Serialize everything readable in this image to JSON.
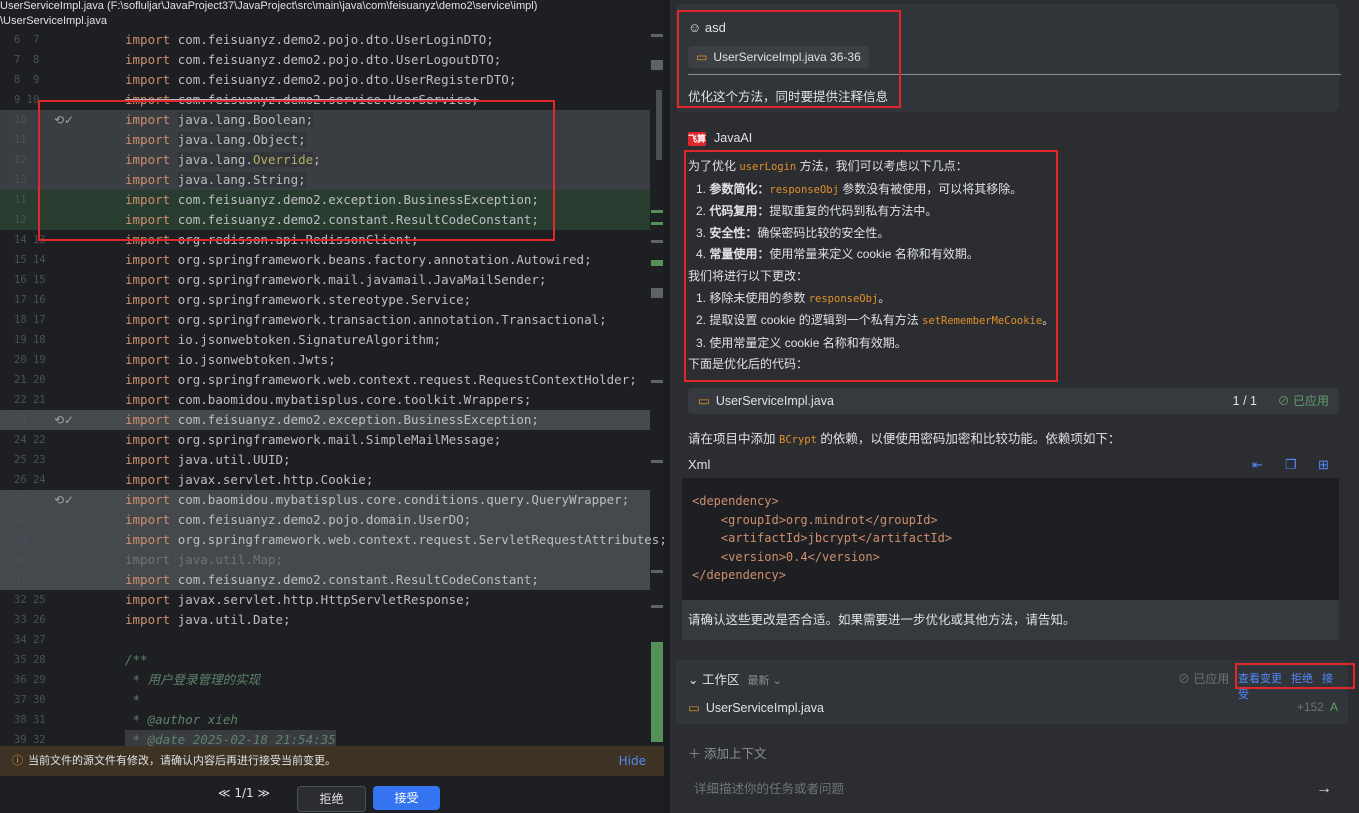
{
  "editor": {
    "path_line1": "UserServiceImpl.java (F:\\sofluljar\\JavaProject37\\JavaProject\\src\\main\\java\\com\\feisuanyz\\demo2\\service\\impl)",
    "path_line2": "\\UserServiceImpl.java",
    "lines": [
      {
        "ln": "6  7",
        "text": "com.feisuanyz.demo2.pojo.dto.UserLoginDTO;"
      },
      {
        "ln": "7  8",
        "text": "com.feisuanyz.demo2.pojo.dto.UserLogoutDTO;"
      },
      {
        "ln": "8  9",
        "text": "com.feisuanyz.demo2.pojo.dto.UserRegisterDTO;"
      },
      {
        "ln": "9 10",
        "text": "com.feisuanyz.demo2.service.UserService;"
      },
      {
        "ln": "10",
        "text": "java.lang.Boolean;"
      },
      {
        "ln": "11",
        "text": "java.lang.Object;"
      },
      {
        "ln": "12",
        "text": "java.lang."
      },
      {
        "ln": "13",
        "text": "java.lang.String;"
      },
      {
        "ln": "11",
        "text": "com.feisuanyz.demo2.exception.BusinessException;"
      },
      {
        "ln": "12",
        "text": "com.feisuanyz.demo2.constant.ResultCodeConstant;"
      },
      {
        "ln": "14 13",
        "text": "org.redisson.api.RedissonClient;"
      },
      {
        "ln": "15 14",
        "text": "org.springframework.beans.factory.annotation.Autowired;"
      },
      {
        "ln": "16 15",
        "text": "org.springframework.mail.javamail.JavaMailSender;"
      },
      {
        "ln": "17 16",
        "text": "org.springframework.stereotype.Service;"
      },
      {
        "ln": "18 17",
        "text": "org.springframework.transaction.annotation.Transactional;"
      },
      {
        "ln": "19 18",
        "text": "io.jsonwebtoken.SignatureAlgorithm;"
      },
      {
        "ln": "20 19",
        "text": "io.jsonwebtoken.Jwts;"
      },
      {
        "ln": "21 20",
        "text": "org.springframework.web.context.request.RequestContextHolder;"
      },
      {
        "ln": "22 21",
        "text": "com.baomidou.mybatisplus.core.toolkit.Wrappers;"
      },
      {
        "ln": "23",
        "text": "com.feisuanyz.demo2.exception.BusinessException;"
      },
      {
        "ln": "24 22",
        "text": "org.springframework.mail.SimpleMailMessage;"
      },
      {
        "ln": "25 23",
        "text": "java.util.UUID;"
      },
      {
        "ln": "26 24",
        "text": "javax.servlet.http.Cookie;"
      },
      {
        "ln": "27",
        "text": "com.baomidou.mybatisplus.core.conditions.query.QueryWrapper;"
      },
      {
        "ln": "28",
        "text": "com.feisuanyz.demo2.pojo.domain.UserDO;"
      },
      {
        "ln": "29",
        "text": "org.springframework.web.context.request.ServletRequestAttributes;"
      },
      {
        "ln": "30",
        "text": "java.util.Map;"
      },
      {
        "ln": "31",
        "text": "com.feisuanyz.demo2.constant.ResultCodeConstant;"
      },
      {
        "ln": "32 25",
        "text": "javax.servlet.http.HttpServletResponse;"
      },
      {
        "ln": "33 26",
        "text": "java.util.Date;"
      }
    ],
    "keyword": "import",
    "override_word": "Override",
    "revert_glyph": "⟲✓",
    "comment_open": "/**",
    "comment_line1": " * 用户登录管理的实现",
    "comment_line2": " *",
    "comment_line3": " * @author xieh",
    "comment_line4": " * @date 2025-02-18 21:54:35",
    "ln_34": "34 27",
    "ln_35": "35 28",
    "ln_36": "36 29",
    "ln_37": "37 30",
    "ln_38": "38 31",
    "ln_39": "39 32"
  },
  "notification": {
    "text": "当前文件的源文件有修改，请确认内容后再进行接受当前变更。",
    "hide": "Hide"
  },
  "diffbar": {
    "nav": "≪ 1/1 ≫",
    "reject": "拒绝",
    "accept": "接受"
  },
  "chat": {
    "user_name": "asd",
    "user_chip": "UserServiceImpl.java 36-36",
    "question": "优化这个方法，同时要提供注释信息",
    "ai_name": "JavaAI",
    "ai_logo": "飞算",
    "intro_a": "为了优化",
    "intro_code": "userLogin",
    "intro_b": "方法，我们可以考虑以下几点：",
    "points": [
      {
        "n": "1.",
        "b": "参数简化：",
        "code": "responseObj",
        "t": "参数没有被使用，可以将其移除。"
      },
      {
        "n": "2.",
        "b": "代码复用：",
        "code": "",
        "t": "提取重复的代码到私有方法中。"
      },
      {
        "n": "3.",
        "b": "安全性：",
        "code": "",
        "t": "确保密码比较的安全性。"
      },
      {
        "n": "4.",
        "b": "常量使用：",
        "code": "",
        "t": "使用常量来定义 cookie 名称和有效期。"
      }
    ],
    "changes_title": "我们将进行以下更改：",
    "changes": [
      {
        "n": "1.",
        "t": "移除未使用的参数",
        "code": "responseObj",
        "t2": "。"
      },
      {
        "n": "2.",
        "t": "提取设置 cookie 的逻辑到一个私有方法",
        "code": "setRememberMeCookie",
        "t2": "。"
      },
      {
        "n": "3.",
        "t": "使用常量定义 cookie 名称和有效期。",
        "code": "",
        "t2": ""
      }
    ],
    "after": "下面是优化后的代码：",
    "applied_file": "UserServiceImpl.java",
    "applied_count": "1 / 1",
    "applied_status": "已应用",
    "para_a": "请在项目中添加",
    "para_code": "BCrypt",
    "para_b": "的依赖，以便使用密码加密和比较功能。依赖项如下：",
    "xml_label": "Xml",
    "xml_lines": [
      "<dependency>",
      "    <groupId>org.mindrot</groupId>",
      "    <artifactId>jbcrypt</artifactId>",
      "    <version>0.4</version>",
      "</dependency>"
    ],
    "confirm": "请确认这些更改是否合适。如果需要进一步优化或其他方法，请告知。"
  },
  "workspace": {
    "title": "工作区",
    "latest": "最新",
    "applied": "已应用",
    "view_changes": "查看变更",
    "reject": "拒绝",
    "accept": "接受",
    "file": "UserServiceImpl.java",
    "stat": "+152",
    "stat_flag": "A"
  },
  "input": {
    "add_context": "添加上下文",
    "placeholder": "详细描述你的任务或者问题",
    "send": "→"
  },
  "colors": {
    "accent": "#3574f0",
    "highlight_box": "#e0272c",
    "added": "#293c30",
    "removed": "#3a3d41"
  }
}
